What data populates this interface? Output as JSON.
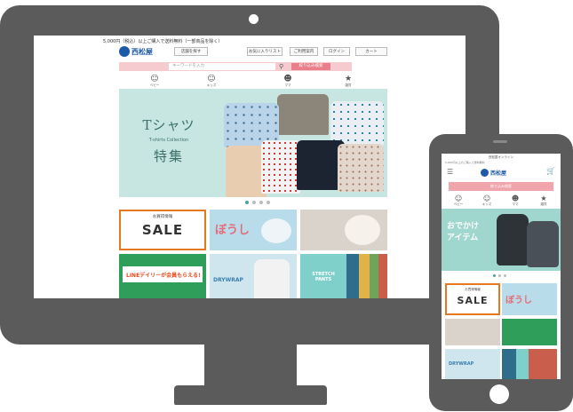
{
  "desktop": {
    "notice": "5,000円（税込）以上ご購入で送料無料（一部商品を除く）",
    "logo_text": "西松屋",
    "header_buttons": [
      "店舗を探す",
      "お気に入りリスト",
      "ご利用案内",
      "ログイン",
      "カート"
    ],
    "search": {
      "placeholder": "キーワードを入力",
      "button_label": "絞り込み検索"
    },
    "categories": [
      "ベビー",
      "キッズ",
      "ママ",
      "雑貨"
    ],
    "hero": {
      "title_line1": "Tシャツ",
      "subtitle": "T-shirts Collection",
      "title_line2": "特集"
    },
    "carousel": {
      "count": 4,
      "active_index": 0
    },
    "tiles": {
      "sale_label": "お買得情報",
      "sale_big": "SALE",
      "boushi": "ぼうし",
      "wrap_text": "DRYWRAP",
      "stretch_text": "STRETCH PANTS",
      "line_text": "LINEデイリーが会員もらえる!"
    }
  },
  "phone": {
    "notice": "西松屋オンライン",
    "notice2": "5,000円以上のご購入で送料無料",
    "logo_text": "西松屋",
    "search_label": "絞り込み検索",
    "categories": [
      "ベビー",
      "キッズ",
      "ママ",
      "雑貨"
    ],
    "hero_text_line1": "おでかけ",
    "hero_text_line2": "アイテム",
    "sale_label": "お買得情報",
    "sale_big": "SALE",
    "boushi": "ぼうし",
    "wrap_text": "DRYWRAP"
  }
}
